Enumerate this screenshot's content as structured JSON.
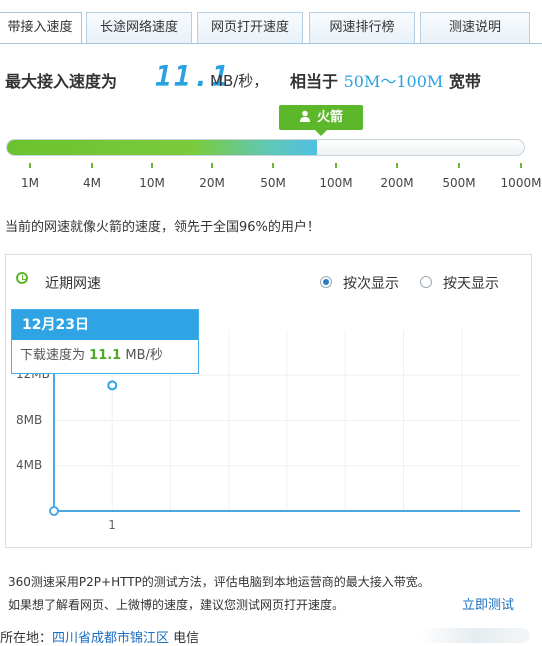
{
  "tabs": [
    {
      "label": "带接入速度",
      "active": true
    },
    {
      "label": "长途网络速度",
      "active": false
    },
    {
      "label": "网页打开速度",
      "active": false
    },
    {
      "label": "网速排行榜",
      "active": false
    },
    {
      "label": "测速说明",
      "active": false
    }
  ],
  "result": {
    "prefix": "最大接入速度为",
    "speed": "11.1",
    "unit": "MB/秒，",
    "equiv_prefix": "相当于",
    "bandwidth": "50M～100M",
    "equiv_suffix": "宽带"
  },
  "rank": {
    "label": "火箭",
    "icon": "user-icon",
    "color": "#5cb82a"
  },
  "meter": {
    "fill_fraction": 0.6,
    "scale": [
      "1M",
      "4M",
      "10M",
      "20M",
      "50M",
      "100M",
      "200M",
      "500M",
      "1000M"
    ]
  },
  "comparison": "当前的网速就像火箭的速度，领先于全国96%的用户！",
  "history": {
    "title": "近期网速",
    "options": {
      "by_count": "按次显示",
      "by_day": "按天显示"
    },
    "selected": "by_count",
    "tooltip": {
      "date": "12月23日",
      "prefix": "下载速度为",
      "value": "11.1",
      "unit": "MB/秒"
    }
  },
  "chart_data": {
    "type": "line",
    "x": [
      1
    ],
    "categories": [
      "1"
    ],
    "series": [
      {
        "values": [
          11.1
        ]
      }
    ],
    "yticks": [
      "4MB",
      "8MB",
      "12MB"
    ],
    "ylim": [
      0,
      16
    ],
    "xlim": [
      0,
      8
    ],
    "grid": true,
    "color": "#2ea4e4"
  },
  "note": {
    "line1": "360测速采用P2P+HTTP的测试方法，评估电脑到本地运营商的最大接入带宽。",
    "line2": "如果想了解看网页、上微博的速度，建议您测试网页打开速度。",
    "link": "立即测试"
  },
  "location": {
    "label": "所在地：",
    "city": "四川省成都市锦江区",
    "isp": "电信"
  }
}
